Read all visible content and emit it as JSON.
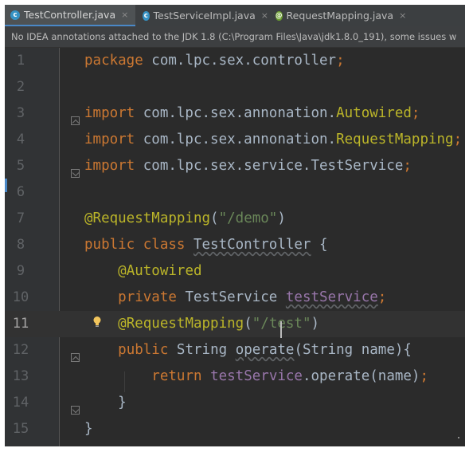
{
  "tabs": [
    {
      "label": "TestController.java",
      "icon": "c-class-icon",
      "active": true,
      "close": "×"
    },
    {
      "label": "TestServiceImpl.java",
      "icon": "c-class-icon",
      "active": false,
      "close": "×"
    },
    {
      "label": "RequestMapping.java",
      "icon": "annotation-icon",
      "active": false,
      "close": "×"
    }
  ],
  "tab_icon_letters": {
    "class": "c",
    "annotation": "@"
  },
  "notice": "No IDEA annotations attached to the JDK 1.8 (C:\\Program Files\\Java\\jdk1.8.0_191), some issues w",
  "editor": {
    "current_line": 11,
    "lines": [
      {
        "n": "1",
        "tokens": [
          [
            "package",
            "kw"
          ],
          [
            " com.lpc.sex.controller",
            ""
          ],
          [
            ";",
            "sem"
          ]
        ]
      },
      {
        "n": "2",
        "tokens": []
      },
      {
        "n": "3",
        "tokens": [
          [
            "import",
            "kw"
          ],
          [
            " com.lpc.sex.annonation.",
            ""
          ],
          [
            "Autowired",
            "an"
          ],
          [
            ";",
            "sem"
          ]
        ]
      },
      {
        "n": "4",
        "tokens": [
          [
            "import",
            "kw"
          ],
          [
            " com.lpc.sex.annonation.",
            ""
          ],
          [
            "RequestMapping",
            "an"
          ],
          [
            ";",
            "sem"
          ]
        ]
      },
      {
        "n": "5",
        "tokens": [
          [
            "import",
            "kw"
          ],
          [
            " com.lpc.sex.service.TestService",
            ""
          ],
          [
            ";",
            "sem"
          ]
        ]
      },
      {
        "n": "6",
        "tokens": []
      },
      {
        "n": "7",
        "tokens": [
          [
            "@RequestMapping",
            "an"
          ],
          [
            "(",
            ""
          ],
          [
            "\"/demo\"",
            "st"
          ],
          [
            ")",
            ""
          ]
        ]
      },
      {
        "n": "8",
        "tokens": [
          [
            "public class ",
            "kw"
          ],
          [
            "TestController",
            "u"
          ],
          [
            " {",
            ""
          ]
        ]
      },
      {
        "n": "9",
        "tokens": [
          [
            "    ",
            ""
          ],
          [
            "@Autowired",
            "an"
          ]
        ]
      },
      {
        "n": "10",
        "tokens": [
          [
            "    ",
            ""
          ],
          [
            "private ",
            "kw"
          ],
          [
            "TestService ",
            ""
          ],
          [
            "testService",
            "fld u"
          ],
          [
            ";",
            "sem"
          ]
        ]
      },
      {
        "n": "11",
        "tokens": [
          [
            "    ",
            ""
          ],
          [
            "@RequestMapping",
            "an"
          ],
          [
            "(",
            ""
          ],
          [
            "\"/test\"",
            "st"
          ],
          [
            ")",
            ""
          ]
        ]
      },
      {
        "n": "12",
        "tokens": [
          [
            "    ",
            ""
          ],
          [
            "public ",
            "kw"
          ],
          [
            "String ",
            ""
          ],
          [
            "operate",
            "u"
          ],
          [
            "(String name){",
            ""
          ]
        ]
      },
      {
        "n": "13",
        "tokens": [
          [
            "        ",
            ""
          ],
          [
            "return ",
            "kw"
          ],
          [
            "testService",
            "fld"
          ],
          [
            ".operate(name)",
            ""
          ],
          [
            ";",
            "sem"
          ]
        ]
      },
      {
        "n": "14",
        "tokens": [
          [
            "    }",
            ""
          ]
        ]
      },
      {
        "n": "15",
        "tokens": [
          [
            "}",
            ""
          ]
        ]
      }
    ]
  },
  "colors": {
    "background": "#2b2b2b",
    "gutter": "#313335",
    "keyword": "#cc7832",
    "annotation": "#bbb529",
    "string": "#6a8759",
    "field": "#9876aa",
    "text": "#a9b7c6",
    "line_number": "#606366",
    "current_line": "#323232",
    "active_tab_underline": "#4a88c7"
  }
}
